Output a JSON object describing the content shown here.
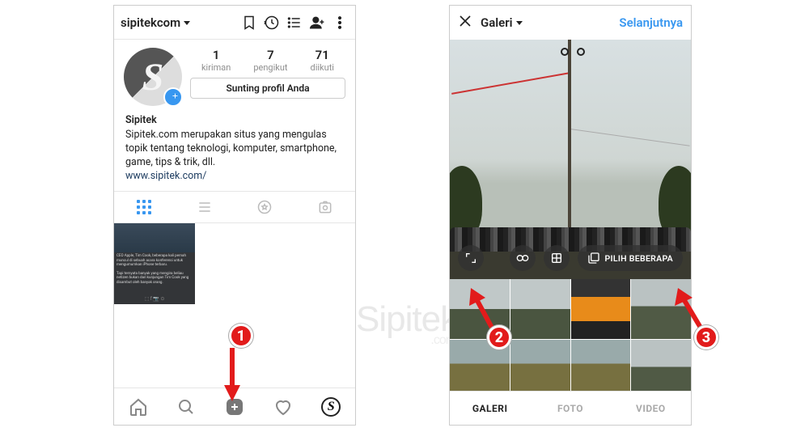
{
  "watermark": {
    "brand": "Sipitek",
    "suffix": ".com"
  },
  "annotations": {
    "one": "1",
    "two": "2",
    "three": "3"
  },
  "left": {
    "username": "sipitekcom",
    "stats": {
      "posts": {
        "value": "1",
        "label": "kiriman"
      },
      "followers": {
        "value": "7",
        "label": "pengikut"
      },
      "following": {
        "value": "71",
        "label": "diikuti"
      }
    },
    "edit_button": "Sunting profil Anda",
    "bio": {
      "name": "Sipitek",
      "text": "Sipitek.com merupakan situs yang mengulas topik tentang teknologi, komputer, smartphone, game, tips & trik, dll.",
      "link": "www.sipitek.com/"
    },
    "avatar_letter": "S"
  },
  "right": {
    "gallery_label": "Galeri",
    "next_label": "Selanjutnya",
    "multi_select": "PILIH BEBERAPA",
    "tabs": {
      "gallery": "GALERI",
      "photo": "FOTO",
      "video": "VIDEO"
    }
  }
}
